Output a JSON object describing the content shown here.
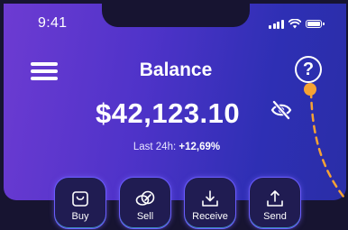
{
  "status_bar": {
    "time": "9:41",
    "icons": [
      "cellular-signal-icon",
      "wifi-icon",
      "battery-icon"
    ]
  },
  "header": {
    "title": "Balance",
    "menu_icon": "hamburger-menu-icon",
    "help_icon": "question-mark-icon",
    "help_glyph": "?"
  },
  "balance": {
    "amount": "$42,123.10",
    "visibility_icon": "eye-slash-icon"
  },
  "change": {
    "label": "Last 24h:",
    "value": "+12,69%"
  },
  "actions": [
    {
      "label": "Buy",
      "icon": "shopping-bag-icon"
    },
    {
      "label": "Sell",
      "icon": "coins-icon"
    },
    {
      "label": "Receive",
      "icon": "download-icon"
    },
    {
      "label": "Send",
      "icon": "upload-icon"
    }
  ],
  "colors": {
    "background": "#171431",
    "gradient_start": "#6d3bd2",
    "gradient_end": "#2a2ea7",
    "accent_orange": "#f6a234",
    "button_border": "#6a5cff"
  }
}
